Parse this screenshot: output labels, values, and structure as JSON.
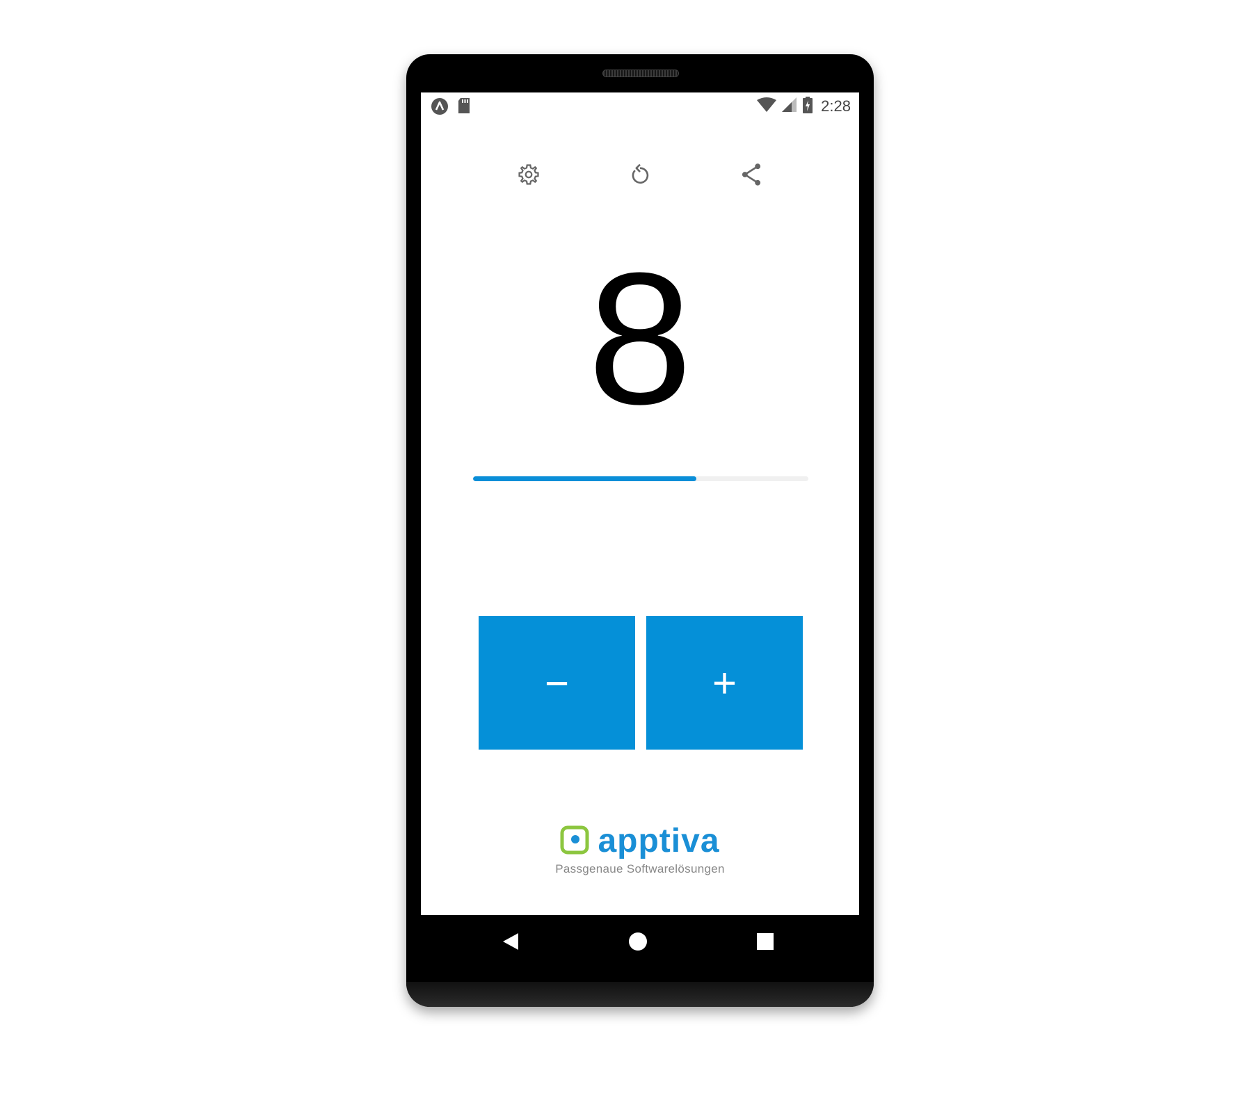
{
  "status_bar": {
    "time": "2:28",
    "left_icons": [
      "app-notification-icon",
      "sd-card-icon"
    ],
    "right_icons": [
      "wifi-icon",
      "cell-signal-icon",
      "battery-charging-icon"
    ]
  },
  "toolbar": {
    "icons": [
      "settings-icon",
      "reset-icon",
      "share-icon"
    ]
  },
  "counter": {
    "value": "8",
    "progress_fraction": 0.665
  },
  "buttons": {
    "decrement_label": "−",
    "increment_label": "+"
  },
  "brand": {
    "name": "apptiva",
    "tagline": "Passgenaue Softwarelösungen"
  },
  "nav_bar": {
    "icons": [
      "back-icon",
      "home-icon",
      "recents-icon"
    ]
  },
  "colors": {
    "accent": "#0590d8",
    "logo_green": "#8cc63f",
    "progress_track": "#f0f0f0"
  }
}
